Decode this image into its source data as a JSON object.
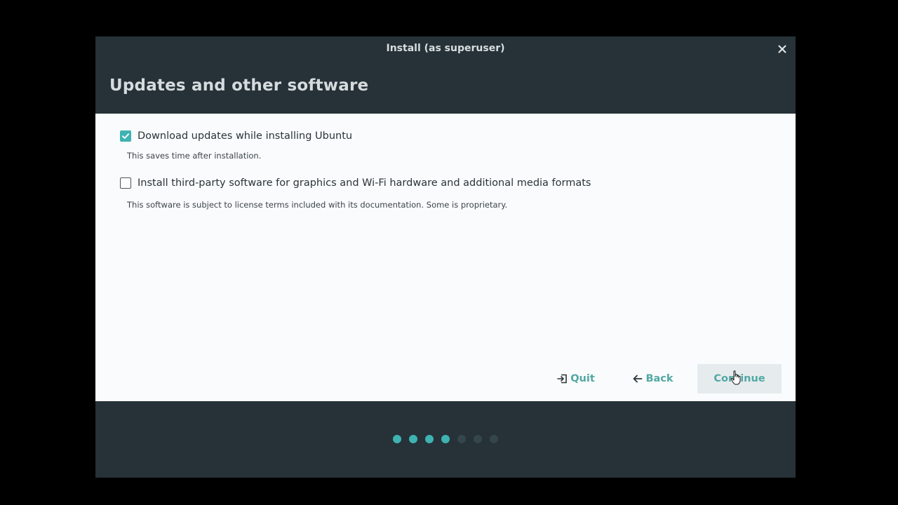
{
  "window": {
    "title": "Install (as superuser)",
    "page_title": "Updates and other software"
  },
  "options": [
    {
      "label": "Download updates while installing Ubuntu",
      "description": "This saves time after installation.",
      "checked": true
    },
    {
      "label": "Install third-party software for graphics and Wi-Fi hardware and additional media formats",
      "description": "This software is subject to license terms included with its documentation. Some is proprietary.",
      "checked": false
    }
  ],
  "buttons": {
    "quit_label": "Quit",
    "back_label": "Back",
    "continue_label": "Continue"
  },
  "progress": {
    "total_steps": 7,
    "completed_steps": 4
  },
  "colors": {
    "accent": "#3eb3b1",
    "header_bg": "#263238",
    "content_bg": "#f9fbfc",
    "dot_inactive": "#34464b"
  },
  "icons": [
    "close-icon",
    "checkmark-icon",
    "quit-icon",
    "arrow-left-icon",
    "mouse-cursor-icon"
  ]
}
